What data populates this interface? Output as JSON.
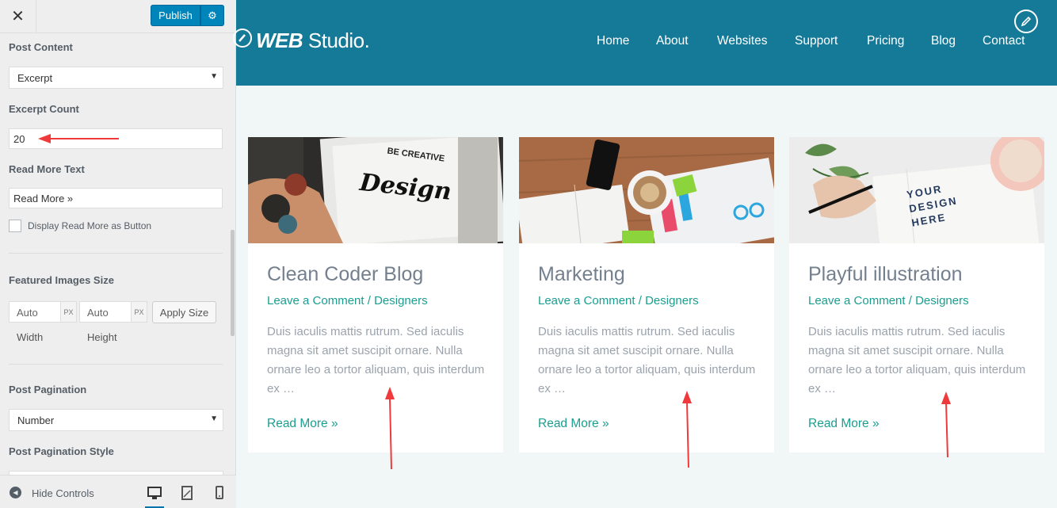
{
  "customizer": {
    "close_glyph": "✕",
    "publish_label": "Publish",
    "gear_glyph": "⚙",
    "post_content_label": "Post Content",
    "post_content_value": "Excerpt",
    "excerpt_count_label": "Excerpt Count",
    "excerpt_count_value": "20",
    "read_more_text_label": "Read More Text",
    "read_more_text_value": "Read More »",
    "display_button_label": "Display Read More as Button",
    "featured_size_label": "Featured Images Size",
    "width_placeholder": "Auto",
    "height_placeholder": "Auto",
    "px_unit": "PX",
    "apply_size_label": "Apply Size",
    "width_caption": "Width",
    "height_caption": "Height",
    "pagination_label": "Post Pagination",
    "pagination_value": "Number",
    "pagination_style_label": "Post Pagination Style",
    "hide_controls_label": "Hide Controls",
    "accent_color": "#0085ba"
  },
  "site": {
    "logo_bold": "WEB",
    "logo_light": " Studio.",
    "nav": [
      "Home",
      "About",
      "Websites",
      "Support",
      "Pricing",
      "Blog",
      "Contact"
    ],
    "header_color": "#147a98",
    "link_color": "#1a9e8f"
  },
  "posts": [
    {
      "title": "Clean Coder Blog",
      "meta": "Leave a Comment / Designers",
      "excerpt": "Duis iaculis mattis rutrum. Sed iaculis magna sit amet suscipit ornare. Nulla ornare leo a tortor aliquam, quis interdum ex …",
      "read_more": "Read More »",
      "image_text_top": "BE CREATIVE",
      "image_text_main": "Design"
    },
    {
      "title": "Marketing",
      "meta": "Leave a Comment / Designers",
      "excerpt": "Duis iaculis mattis rutrum. Sed iaculis magna sit amet suscipit ornare. Nulla ornare leo a tortor aliquam, quis interdum ex …",
      "read_more": "Read More »"
    },
    {
      "title": "Playful illustration",
      "meta": "Leave a Comment / Designers",
      "excerpt": "Duis iaculis mattis rutrum. Sed iaculis magna sit amet suscipit ornare. Nulla ornare leo a tortor aliquam, quis interdum ex …",
      "read_more": "Read More »",
      "image_text": "YOUR DESIGN HERE"
    }
  ],
  "annotation_color": "#f0393a"
}
